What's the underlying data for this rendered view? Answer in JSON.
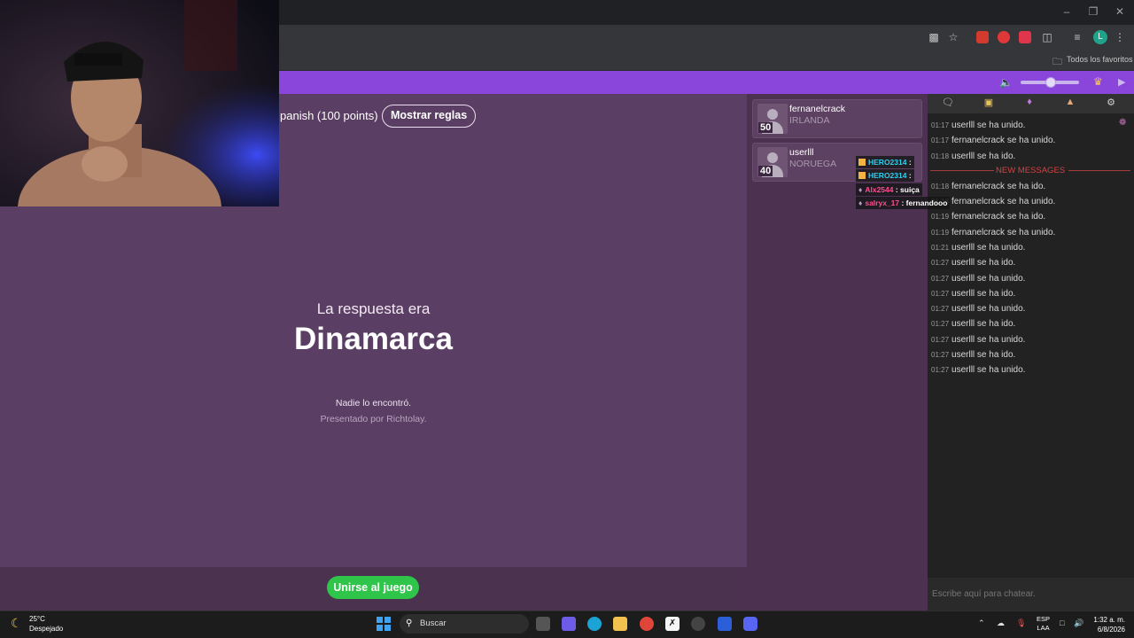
{
  "browser": {
    "bookmarks_label": "Todos los favoritos",
    "profile_initial": "L"
  },
  "game": {
    "points_text": "panish (100 points)",
    "rules_button": "Mostrar reglas",
    "answer_label": "La respuesta era",
    "answer_value": "Dinamarca",
    "nobody_found": "Nadie lo encontró.",
    "presented_by": "Presentado por Richtolay.",
    "join_button": "Unirse al juego"
  },
  "players": [
    {
      "name": "fernanelcrack",
      "country": "IRLANDA",
      "score": "50"
    },
    {
      "name": "userlll",
      "country": "NORUEGA",
      "score": "40"
    }
  ],
  "chat": {
    "new_messages": "NEW MESSAGES",
    "input_placeholder": "Escribe aquí para chatear.",
    "messages": [
      {
        "time": "01:17",
        "text": "userlll se ha unido."
      },
      {
        "time": "01:17",
        "text": "fernanelcrack se ha unido."
      },
      {
        "time": "01:18",
        "text": "userlll se ha ido."
      },
      {
        "time": "01:18",
        "text": "fernanelcrack se ha ido."
      },
      {
        "time": "01:18",
        "text": "fernanelcrack se ha unido."
      },
      {
        "time": "01:19",
        "text": "fernanelcrack se ha ido."
      },
      {
        "time": "01:19",
        "text": "fernanelcrack se ha unido."
      },
      {
        "time": "01:21",
        "text": "userlll se ha unido."
      },
      {
        "time": "01:27",
        "text": "userlll se ha ido."
      },
      {
        "time": "01:27",
        "text": "userlll se ha unido."
      },
      {
        "time": "01:27",
        "text": "userlll se ha ido."
      },
      {
        "time": "01:27",
        "text": "userlll se ha unido."
      },
      {
        "time": "01:27",
        "text": "userlll se ha ido."
      },
      {
        "time": "01:27",
        "text": "userlll se ha unido."
      },
      {
        "time": "01:27",
        "text": "userlll se ha ido."
      },
      {
        "time": "01:27",
        "text": "userlll se ha unido."
      }
    ]
  },
  "overlay_chat": [
    {
      "user": "HERO2314",
      "sep": " :",
      "text": "",
      "user_color": "#27d3f0"
    },
    {
      "user": "HERO2314",
      "sep": " :",
      "text": "",
      "user_color": "#27d3f0"
    },
    {
      "user": "Alx2544",
      "sep": " :",
      "text": " suiça",
      "user_color": "#ff4d8f"
    },
    {
      "user": "salryx_17",
      "sep": " :",
      "text": " fernandooo",
      "user_color": "#ff4d8f"
    }
  ],
  "taskbar": {
    "weather_temp": "25°C",
    "weather_desc": "Despejado",
    "search_label": "Buscar",
    "lang_top": "ESP",
    "lang_bottom": "LAA",
    "time": "1:32 a. m.",
    "date": "6/8/2026"
  },
  "colors": {
    "header_purple": "#8a46db",
    "game_bg": "#5b3e63",
    "join_green": "#2fc54a",
    "new_messages_red": "#c94646"
  }
}
